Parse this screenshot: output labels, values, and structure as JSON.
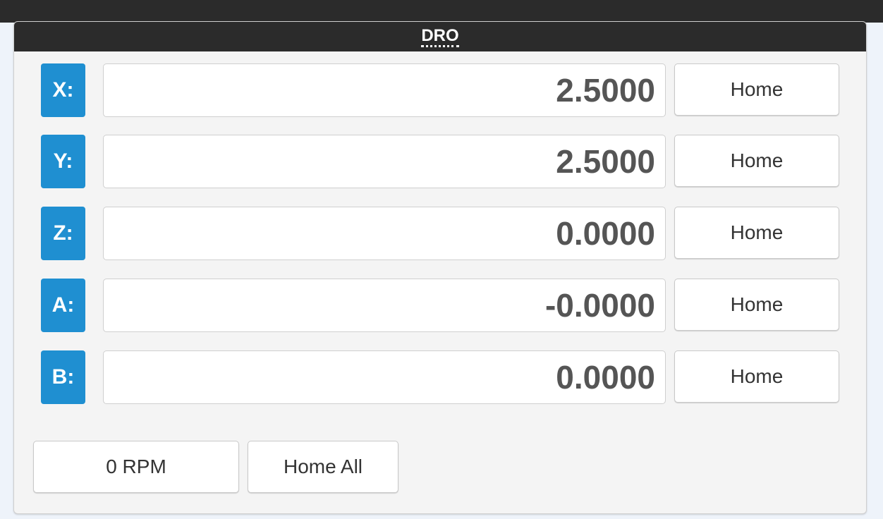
{
  "panel": {
    "title": "DRO"
  },
  "axes": [
    {
      "label": "X:",
      "value": "2.5000",
      "home_label": "Home"
    },
    {
      "label": "Y:",
      "value": "2.5000",
      "home_label": "Home"
    },
    {
      "label": "Z:",
      "value": "0.0000",
      "home_label": "Home"
    },
    {
      "label": "A:",
      "value": "-0.0000",
      "home_label": "Home"
    },
    {
      "label": "B:",
      "value": "0.0000",
      "home_label": "Home"
    }
  ],
  "footer": {
    "rpm_label": "0 RPM",
    "home_all_label": "Home All"
  },
  "colors": {
    "axis_badge": "#1f8fd1",
    "header": "#2b2b2b"
  }
}
